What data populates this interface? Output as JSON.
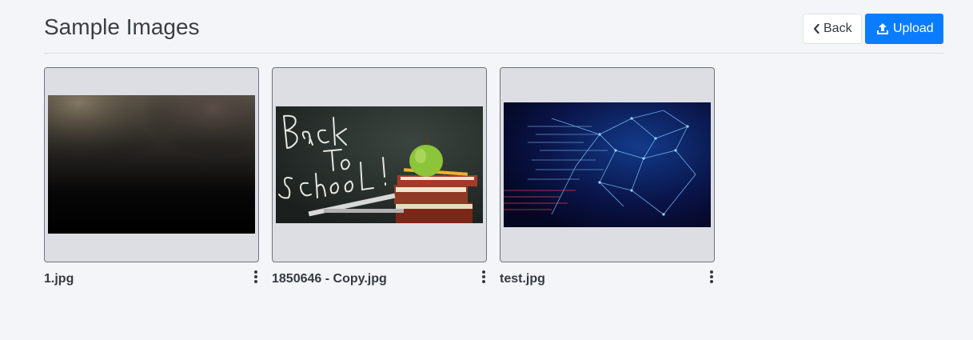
{
  "header": {
    "title": "Sample Images",
    "back_label": "Back",
    "upload_label": "Upload"
  },
  "colors": {
    "primary": "#0a7cff",
    "page_background": "#f4f5f9",
    "card_background": "#dcdee3"
  },
  "images": [
    {
      "name": "1.jpg"
    },
    {
      "name": "1850646 - Copy.jpg"
    },
    {
      "name": "test.jpg"
    }
  ],
  "icons": {
    "back": "chevron-left-icon",
    "upload": "upload-icon",
    "menu": "kebab-menu-icon"
  }
}
